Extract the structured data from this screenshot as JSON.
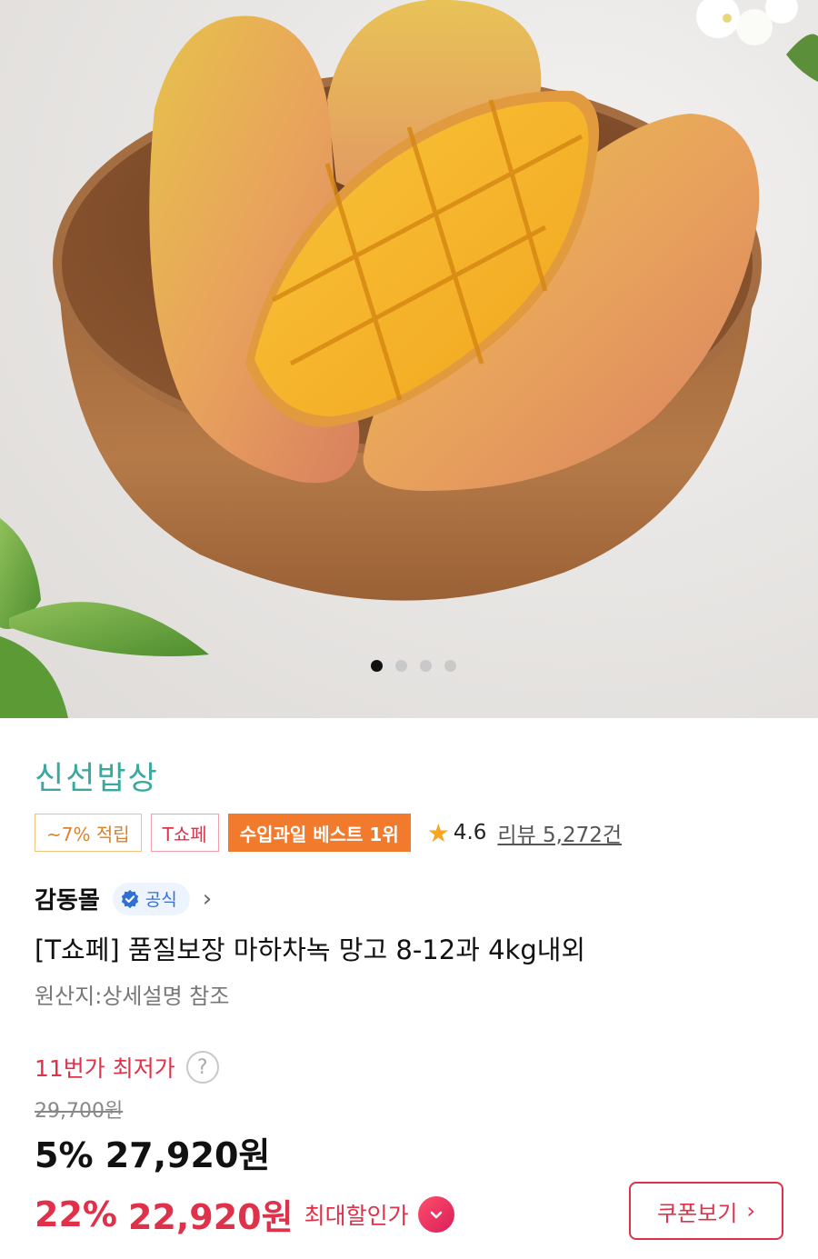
{
  "hero": {
    "image_label": "mango-in-wooden-bowl",
    "carousel": {
      "total": 4,
      "active_index": 0
    }
  },
  "product": {
    "brand": "신선밥상",
    "tags": {
      "reward": "~7% 적립",
      "tshope": "T쇼페",
      "best": "수입과일 베스트 1위"
    },
    "rating": "4.6",
    "review_label": "리뷰 5,272건",
    "seller": "감동몰",
    "official_badge": "공식",
    "title": "[T쇼페] 품질보장 마하차녹 망고 8-12과 4kg내외",
    "origin": "원산지:상세설명 참조"
  },
  "pricing": {
    "lowest_label": "11번가 최저가",
    "help_icon": "?",
    "original_price": "29,700원",
    "discount1": "5% 27,920원",
    "discount2_pct": "22%",
    "discount2_amount": "22,920원",
    "max_discount_label": "최대할인가",
    "coupon_button": "쿠폰보기"
  },
  "colors": {
    "brand_teal": "#3aa89e",
    "accent_red": "#e0314b",
    "best_orange": "#f27a2c",
    "star": "#f5a623"
  }
}
